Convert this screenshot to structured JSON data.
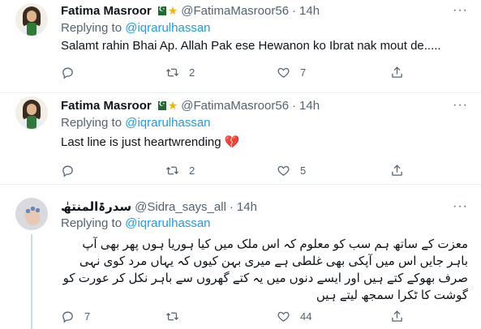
{
  "tweets": [
    {
      "name": "Fatima Masroor",
      "handle": "@FatimaMasroor56",
      "dot": "·",
      "time": "14h",
      "replying_prefix": "Replying to",
      "replying_to": "@iqrarulhassan",
      "text": "Salamt rahin Bhai Ap. Allah Pak ese Hewanon ko Ibrat nak mout de.....",
      "replies": "",
      "retweets": "2",
      "likes": "7",
      "more": "···"
    },
    {
      "name": "Fatima Masroor",
      "handle": "@FatimaMasroor56",
      "dot": "·",
      "time": "14h",
      "replying_prefix": "Replying to",
      "replying_to": "@iqrarulhassan",
      "text": "Last line is just heartwrending",
      "emoji": "💔",
      "replies": "",
      "retweets": "2",
      "likes": "5",
      "more": "···"
    },
    {
      "name": "سدرۃالمنتھٰ",
      "handle": "@Sidra_says_all",
      "dot": "·",
      "time": "14h",
      "replying_prefix": "Replying to",
      "replying_to": "@iqrarulhassan",
      "text": "معزت کے ساتھ ہم سب کو معلوم کہ اس ملک میں کیا ہوریا ہوں پھر بھی آپ باہر جایں اس میں آپکی بھی غلطی ہے میری بہن کیوں کہ یہاں مرد کوی نہی صرف بھوکے کتے ہیں اور ایسے دنوں میں یہ کتے گھروں سے باہر نکل کر عورت کو گوشت کا ٹکرا سمجھ لیتے ہیں",
      "replies": "7",
      "retweets": "",
      "likes": "44",
      "more": "···"
    }
  ],
  "icons": [
    "reply-icon",
    "retweet-icon",
    "like-icon",
    "share-icon",
    "more-icon"
  ],
  "colors": {
    "accent": "#1d9bf0",
    "secondary_text": "#536471",
    "heart_emoji": "#e0245e"
  }
}
